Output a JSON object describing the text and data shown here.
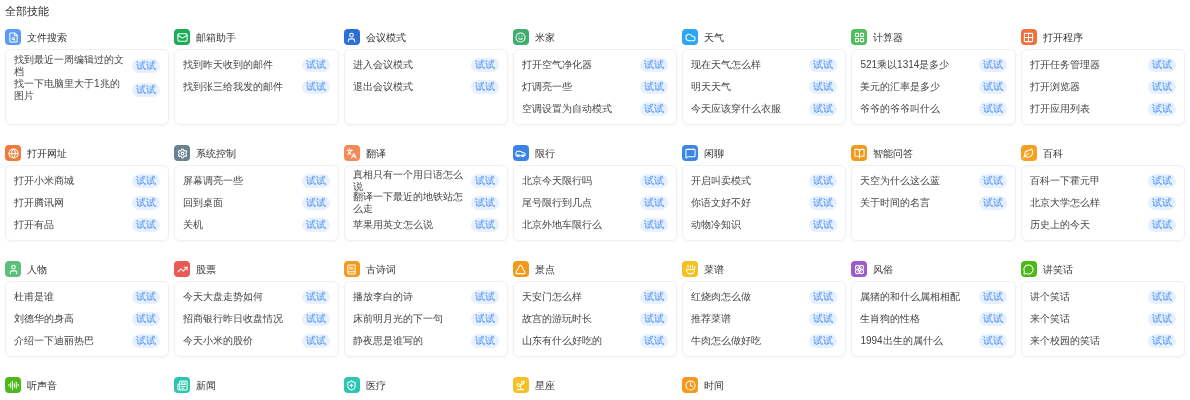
{
  "title": "全部技能",
  "skills": [
    {
      "name": "文件搜索",
      "color": "#5b9cf2",
      "examples": [
        {
          "text": "找到最近一周编辑过的文档",
          "button": "试试"
        },
        {
          "text": "找一下电脑里大于1兆的图片",
          "button": "试试"
        }
      ]
    },
    {
      "name": "邮箱助手",
      "color": "#1aad55",
      "examples": [
        {
          "text": "找到昨天收到的邮件",
          "button": "试试"
        },
        {
          "text": "找到张三给我发的邮件",
          "button": "试试"
        }
      ]
    },
    {
      "name": "会议模式",
      "color": "#2b6fd6",
      "examples": [
        {
          "text": "进入会议模式",
          "button": "试试"
        },
        {
          "text": "退出会议模式",
          "button": "试试"
        }
      ]
    },
    {
      "name": "米家",
      "color": "#3dae6b",
      "examples": [
        {
          "text": "打开空气净化器",
          "button": "试试"
        },
        {
          "text": "灯调亮一些",
          "button": "试试"
        },
        {
          "text": "空调设置为自动模式",
          "button": "试试"
        }
      ]
    },
    {
      "name": "天气",
      "color": "#2aa6f5",
      "examples": [
        {
          "text": "现在天气怎么样",
          "button": "试试"
        },
        {
          "text": "明天天气",
          "button": "试试"
        },
        {
          "text": "今天应该穿什么衣服",
          "button": "试试"
        }
      ]
    },
    {
      "name": "计算器",
      "color": "#4cbe5a",
      "examples": [
        {
          "text": "521乘以1314是多少",
          "button": "试试"
        },
        {
          "text": "美元的汇率是多少",
          "button": "试试"
        },
        {
          "text": "爷爷的爷爷叫什么",
          "button": "试试"
        }
      ]
    },
    {
      "name": "打开程序",
      "color": "#f0703a",
      "examples": [
        {
          "text": "打开任务管理器",
          "button": "试试"
        },
        {
          "text": "打开浏览器",
          "button": "试试"
        },
        {
          "text": "打开应用列表",
          "button": "试试"
        }
      ]
    },
    {
      "name": "打开网址",
      "color": "#f07a3a",
      "examples": [
        {
          "text": "打开小米商城",
          "button": "试试"
        },
        {
          "text": "打开腾讯网",
          "button": "试试"
        },
        {
          "text": "打开有品",
          "button": "试试"
        }
      ]
    },
    {
      "name": "系统控制",
      "color": "#6b8091",
      "examples": [
        {
          "text": "屏幕调亮一些",
          "button": "试试"
        },
        {
          "text": "回到桌面",
          "button": "试试"
        },
        {
          "text": "关机",
          "button": "试试"
        }
      ]
    },
    {
      "name": "翻译",
      "color": "#f48a5a",
      "examples": [
        {
          "text": "真相只有一个用日语怎么说",
          "button": "试试"
        },
        {
          "text": "翻译一下最近的地铁站怎么走",
          "button": "试试"
        },
        {
          "text": "苹果用英文怎么说",
          "button": "试试"
        }
      ]
    },
    {
      "name": "限行",
      "color": "#3c83e6",
      "examples": [
        {
          "text": "北京今天限行吗",
          "button": "试试"
        },
        {
          "text": "尾号限行到几点",
          "button": "试试"
        },
        {
          "text": "北京外地车限行么",
          "button": "试试"
        }
      ]
    },
    {
      "name": "闲聊",
      "color": "#3b87e8",
      "examples": [
        {
          "text": "开启叫卖模式",
          "button": "试试"
        },
        {
          "text": "你语文好不好",
          "button": "试试"
        },
        {
          "text": "动物冷知识",
          "button": "试试"
        }
      ]
    },
    {
      "name": "智能问答",
      "color": "#f39a1e",
      "examples": [
        {
          "text": "天空为什么这么蓝",
          "button": "试试"
        },
        {
          "text": "关于时间的名言",
          "button": "试试"
        }
      ]
    },
    {
      "name": "百科",
      "color": "#f5a020",
      "examples": [
        {
          "text": "百科一下霍元甲",
          "button": "试试"
        },
        {
          "text": "北京大学怎么样",
          "button": "试试"
        },
        {
          "text": "历史上的今天",
          "button": "试试"
        }
      ]
    },
    {
      "name": "人物",
      "color": "#5cbf7a",
      "examples": [
        {
          "text": "杜甫是谁",
          "button": "试试"
        },
        {
          "text": "刘德华的身高",
          "button": "试试"
        },
        {
          "text": "介绍一下迪丽热巴",
          "button": "试试"
        }
      ]
    },
    {
      "name": "股票",
      "color": "#ec5a55",
      "examples": [
        {
          "text": "今天大盘走势如何",
          "button": "试试"
        },
        {
          "text": "招商银行昨日收盘情况",
          "button": "试试"
        },
        {
          "text": "今天小米的股价",
          "button": "试试"
        }
      ]
    },
    {
      "name": "古诗词",
      "color": "#f59a1b",
      "examples": [
        {
          "text": "播放李白的诗",
          "button": "试试"
        },
        {
          "text": "床前明月光的下一句",
          "button": "试试"
        },
        {
          "text": "静夜思是谁写的",
          "button": "试试"
        }
      ]
    },
    {
      "name": "景点",
      "color": "#f39a1c",
      "examples": [
        {
          "text": "天安门怎么样",
          "button": "试试"
        },
        {
          "text": "故宫的游玩时长",
          "button": "试试"
        },
        {
          "text": "山东有什么好吃的",
          "button": "试试"
        }
      ]
    },
    {
      "name": "菜谱",
      "color": "#f5c020",
      "examples": [
        {
          "text": "红烧肉怎么做",
          "button": "试试"
        },
        {
          "text": "推荐菜谱",
          "button": "试试"
        },
        {
          "text": "牛肉怎么做好吃",
          "button": "试试"
        }
      ]
    },
    {
      "name": "风俗",
      "color": "#9b5cc9",
      "examples": [
        {
          "text": "属猪的和什么属相相配",
          "button": "试试"
        },
        {
          "text": "生肖狗的性格",
          "button": "试试"
        },
        {
          "text": "1994出生的属什么",
          "button": "试试"
        }
      ]
    },
    {
      "name": "讲笑话",
      "color": "#4cb81a",
      "examples": [
        {
          "text": "讲个笑话",
          "button": "试试"
        },
        {
          "text": "来个笑话",
          "button": "试试"
        },
        {
          "text": "来个校园的笑话",
          "button": "试试"
        }
      ]
    },
    {
      "name": "听声音",
      "color": "#4cb81b"
    },
    {
      "name": "新闻",
      "color": "#2cc5b0"
    },
    {
      "name": "医疗",
      "color": "#2cc5b1"
    },
    {
      "name": "星座",
      "color": "#f5c021"
    },
    {
      "name": "时间",
      "color": "#f59a1c"
    }
  ]
}
